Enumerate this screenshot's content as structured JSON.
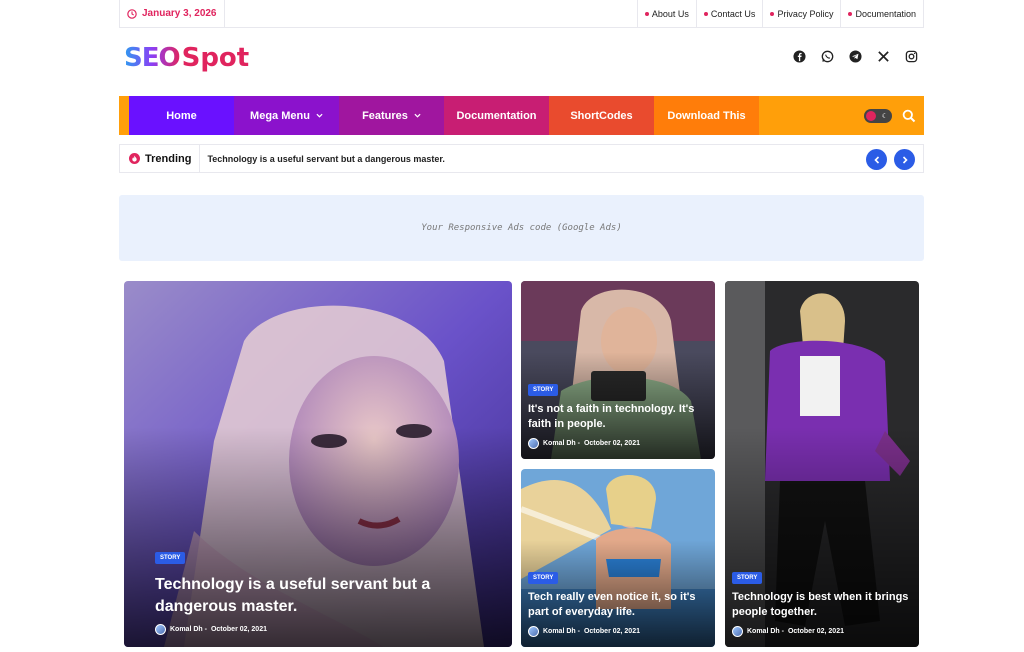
{
  "topbar": {
    "date": "January 3, 2026",
    "links": [
      "About Us",
      "Contact Us",
      "Privacy Policy",
      "Documentation"
    ]
  },
  "header": {
    "logo_part1": "SEO",
    "logo_part2": "Spot",
    "socials": [
      "facebook-icon",
      "whatsapp-icon",
      "telegram-icon",
      "x-icon",
      "instagram-icon"
    ]
  },
  "nav": {
    "items": [
      {
        "label": "Home",
        "color": "#6a11ff"
      },
      {
        "label": "Mega Menu",
        "color": "#8b12cc"
      },
      {
        "label": "Features",
        "color": "#a0169f"
      },
      {
        "label": "Documentation",
        "color": "#c81e73"
      },
      {
        "label": "ShortCodes",
        "color": "#e94b2e"
      },
      {
        "label": "Download This",
        "color": "#ff7d0a"
      }
    ],
    "accent": "#ff9f0a"
  },
  "trending": {
    "label": "Trending",
    "headline": "Technology is a useful servant but a dangerous master."
  },
  "ad": {
    "text": "Your Responsive Ads code (Google Ads)"
  },
  "posts": [
    {
      "badge": "STORY",
      "title": "Technology is a useful servant but a dangerous master.",
      "author": "Komal Dh -",
      "date": "October 02, 2021"
    },
    {
      "badge": "STORY",
      "title": "It's not a faith in technology. It's faith in people.",
      "author": "Komal Dh -",
      "date": "October 02, 2021"
    },
    {
      "badge": "STORY",
      "title": "Tech really even notice it, so it's part of everyday life.",
      "author": "Komal Dh -",
      "date": "October 02, 2021"
    },
    {
      "badge": "STORY",
      "title": "Technology is best when it brings people together.",
      "author": "Komal Dh -",
      "date": "October 02, 2021"
    }
  ]
}
